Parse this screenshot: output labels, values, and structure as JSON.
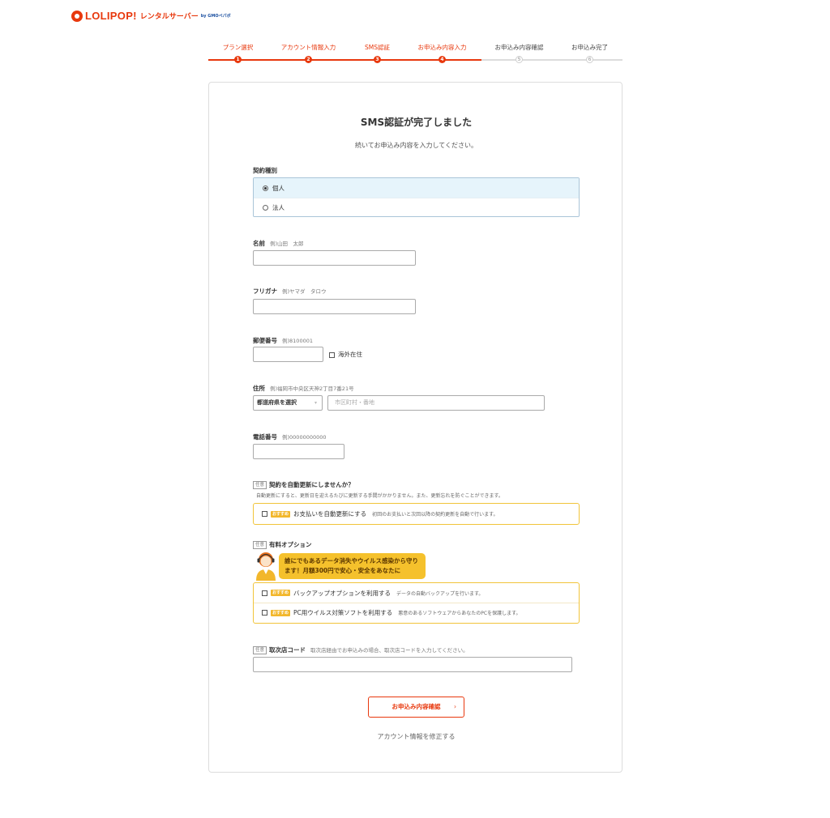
{
  "header": {
    "logo_text": "LOLIPOP!",
    "logo_sub": "レンタルサーバー",
    "logo_gmo": "by GMOペパボ"
  },
  "steps": [
    {
      "label": "プラン選択",
      "num": "1",
      "state": "done"
    },
    {
      "label": "アカウント情報入力",
      "num": "2",
      "state": "done"
    },
    {
      "label": "SMS認証",
      "num": "3",
      "state": "done"
    },
    {
      "label": "お申込み内容入力",
      "num": "4",
      "state": "done"
    },
    {
      "label": "お申込み内容確認",
      "num": "5",
      "state": "todo"
    },
    {
      "label": "お申込み完了",
      "num": "6",
      "state": "todo"
    }
  ],
  "form": {
    "title": "SMS認証が完了しました",
    "subtitle": "続いてお申込み内容を入力してください。",
    "contract": {
      "label": "契約種別",
      "options": [
        {
          "label": "個人",
          "selected": true
        },
        {
          "label": "法人",
          "selected": false
        }
      ]
    },
    "name": {
      "label": "名前",
      "hint": "例)山田　太郎",
      "value": ""
    },
    "kana": {
      "label": "フリガナ",
      "hint": "例)ヤマダ　タロウ",
      "value": ""
    },
    "postal": {
      "label": "郵便番号",
      "hint": "例)8100001",
      "value": "",
      "overseas_label": "海外在住"
    },
    "address": {
      "label": "住所",
      "hint": "例)福岡市中央区天神2丁目7番21号",
      "pref_select": "都道府県を選択",
      "city_placeholder": "市区町村・番地"
    },
    "phone": {
      "label": "電話番号",
      "hint": "例)00000000000",
      "value": ""
    },
    "auto_renew": {
      "tag": "任意",
      "label": "契約を自動更新にしませんか？",
      "description": "自動更新にすると、更新日を迎えるたびに更新する手間がかかりません。また、更新忘れを防ぐことができます。",
      "badge": "おすすめ",
      "option_label": "お支払いを自動更新にする",
      "option_desc": "初回のお支払いと次回以降の契約更新を自動で行います。"
    },
    "paid_options": {
      "tag": "任意",
      "label": "有料オプション",
      "bubble_line1": "誰にでもあるデータ消失やウイルス感染から守り",
      "bubble_line2": "ます！月額300円で安心・安全をあなたに",
      "items": [
        {
          "badge": "おすすめ",
          "label": "バックアップオプションを利用する",
          "desc": "データの自動バックアップを行います。"
        },
        {
          "badge": "おすすめ",
          "label": "PC用ウイルス対策ソフトを利用する",
          "desc": "悪意のあるソフトウェアからあなたのPCを保護します。"
        }
      ]
    },
    "agency": {
      "tag": "任意",
      "label": "取次店コード",
      "hint": "取次店経由でお申込みの場合、取次店コードを入力してください。",
      "value": ""
    },
    "submit_label": "お申込み内容確認",
    "back_link": "アカウント情報を修正する"
  },
  "colors": {
    "accent": "#e8380d",
    "option_border": "#f1c43a",
    "selected_bg": "#e6f4fb"
  }
}
